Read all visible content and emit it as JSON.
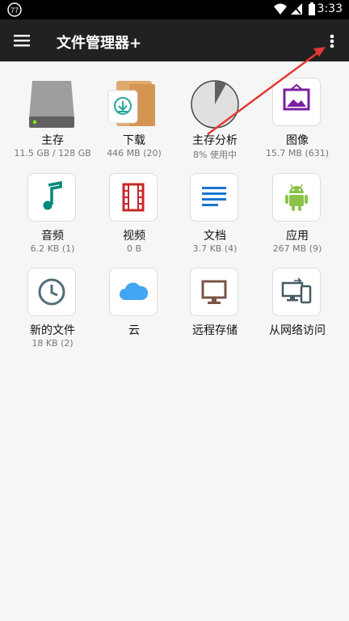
{
  "status_bar": {
    "notification_badge": "77",
    "time": "3:33"
  },
  "app_bar": {
    "title": "文件管理器+"
  },
  "tiles": [
    {
      "label": "主存",
      "sub": "11.5 GB / 128 GB"
    },
    {
      "label": "下载",
      "sub": "446 MB (20)"
    },
    {
      "label": "主存分析",
      "sub": "8% 使用中"
    },
    {
      "label": "图像",
      "sub": "15.7 MB (631)"
    },
    {
      "label": "音频",
      "sub": "6.2 KB (1)"
    },
    {
      "label": "视频",
      "sub": "0 B"
    },
    {
      "label": "文档",
      "sub": "3.7 KB (4)"
    },
    {
      "label": "应用",
      "sub": "267 MB (9)"
    },
    {
      "label": "新的文件",
      "sub": "18 KB (2)"
    },
    {
      "label": "云",
      "sub": ""
    },
    {
      "label": "远程存储",
      "sub": ""
    },
    {
      "label": "从网络访问",
      "sub": ""
    }
  ],
  "storage_used_percent": 8,
  "colors": {
    "app_bar": "#212121",
    "audio_icon": "#00897b",
    "video_icon": "#c62828",
    "document_icon": "#1976d2",
    "android_icon": "#8bc34a",
    "image_icon": "#7b1fa2",
    "cloud_icon": "#42a5f5",
    "remote_icon": "#795548",
    "network_icon": "#455a64",
    "annotation_arrow": "#e53935"
  }
}
